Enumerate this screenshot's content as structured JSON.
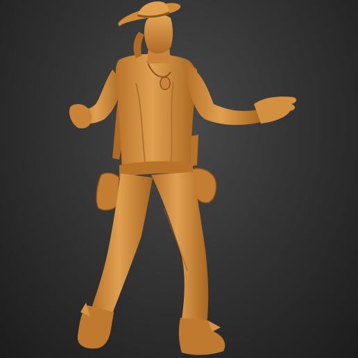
{
  "viewport": {
    "background_top": "#4a4a4a",
    "background_bottom": "#1c1c1c"
  },
  "model": {
    "material_color": "#d08a3a",
    "shadow_color": "#8a5418",
    "highlight_color": "#eab061"
  }
}
